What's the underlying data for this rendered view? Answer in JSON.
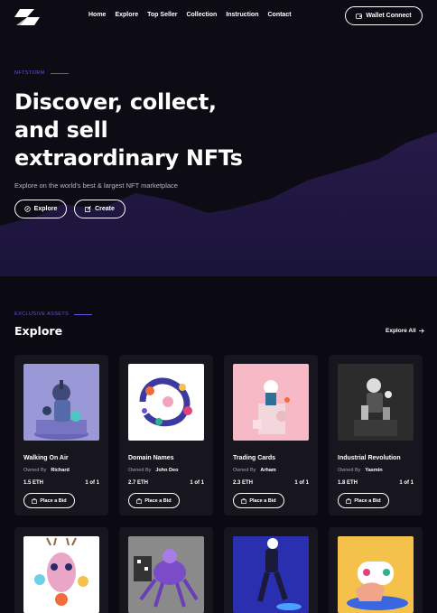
{
  "nav": {
    "links": [
      "Home",
      "Explore",
      "Top Seller",
      "Collection",
      "Instruction",
      "Contact"
    ],
    "wallet_label": "Wallet Connect"
  },
  "hero": {
    "eyebrow": "NFTSTORM",
    "title_lines": [
      "Discover, collect,",
      "and sell",
      "extraordinary NFTs"
    ],
    "subtitle": "Explore on the world's best & largest NFT marketplace",
    "explore_label": "Explore",
    "create_label": "Create"
  },
  "section": {
    "eyebrow": "EXCLUSIVE ASSETS",
    "title": "Explore",
    "explore_all": "Explore All"
  },
  "cards": [
    {
      "title": "Walking On Air",
      "owned_by_label": "Owned By",
      "owner": "Richard",
      "price": "1.5 ETH",
      "edition": "1 of 1",
      "bid_label": "Place a Bid",
      "bg": "#9b98d8"
    },
    {
      "title": "Domain Names",
      "owned_by_label": "Owned By",
      "owner": "John Deo",
      "price": "2.7 ETH",
      "edition": "1 of 1",
      "bid_label": "Place a Bid",
      "bg": "#ffffff"
    },
    {
      "title": "Trading Cards",
      "owned_by_label": "Owned By",
      "owner": "Arham",
      "price": "2.3 ETH",
      "edition": "1 of 1",
      "bid_label": "Place a Bid",
      "bg": "#f7b9c6"
    },
    {
      "title": "Industrial Revolution",
      "owned_by_label": "Owned By",
      "owner": "Yasmin",
      "price": "1.8 ETH",
      "edition": "1 of 1",
      "bid_label": "Place a Bid",
      "bg": "#2c2c2c"
    }
  ],
  "row2_backgrounds": [
    "#ffffff",
    "#8a8a8a",
    "#2a2fb0",
    "#f4c14a"
  ],
  "colors": {
    "background": "#0b0a12",
    "accent": "#6c4ee6",
    "card": "#17161e",
    "hero_mountain": "#2a1b4a"
  },
  "icons": {
    "wallet": "wallet-icon",
    "explore": "compass-icon",
    "create": "edit-icon",
    "bid": "bag-icon",
    "arrow": "arrow-right-icon"
  }
}
